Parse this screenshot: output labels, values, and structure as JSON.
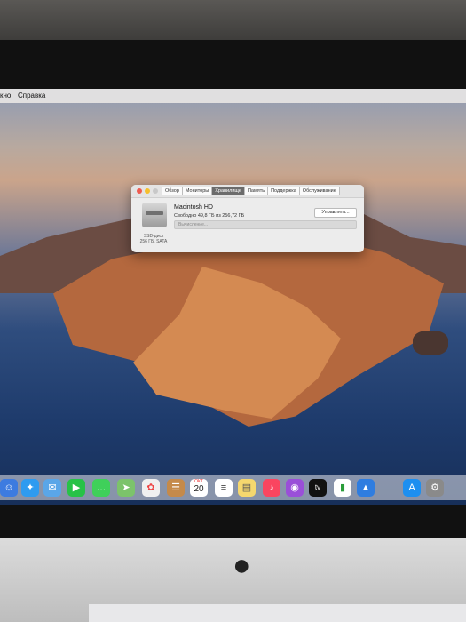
{
  "menubar": {
    "items": [
      "кно",
      "Справка"
    ]
  },
  "window": {
    "tabs": [
      "Обзор",
      "Мониторы",
      "Хранилище",
      "Память",
      "Поддержка",
      "Обслуживание"
    ],
    "active_tab_index": 2,
    "volume_name": "Macintosh HD",
    "free_space": "Свободно 49,8 ГБ из 256,72 ГБ",
    "manage_button": "Управлять...",
    "progress_text": "Вычисление...",
    "disk_label": "SSD-диск\n256 ГБ, SATA"
  },
  "dock": {
    "apps": [
      "finder-icon",
      "safari-icon",
      "mail-icon",
      "facetime-icon",
      "messages-icon",
      "maps-icon",
      "photos-icon",
      "contacts-icon",
      "calendar-icon",
      "reminders-icon",
      "notes-icon",
      "music-icon",
      "podcasts-icon",
      "appletv-icon",
      "numbers-icon",
      "keynote-icon",
      "appstore-icon",
      "settings-icon"
    ],
    "calendar_day": "20",
    "calendar_month": "ОКТ",
    "tv_label": "tv"
  }
}
